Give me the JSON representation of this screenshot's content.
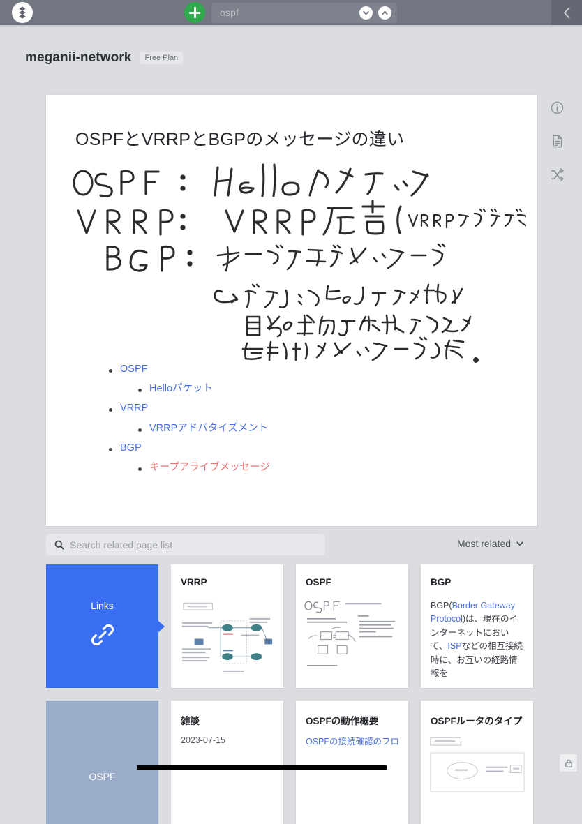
{
  "navbar": {
    "logo_name": "growi-logo",
    "create_button_label": "+",
    "search": {
      "value": "ospf",
      "placeholder": "ospf"
    },
    "search_dropdown_icon": "chevron-down-icon",
    "search_up_icon": "chevron-up-icon",
    "collapse_icon": "chevron-left-icon"
  },
  "page_header": {
    "title": "meganii-network",
    "plan_badge": "Free Plan"
  },
  "content": {
    "title": "OSPFとVRRPとBGPのメッセージの違い",
    "handwriting": {
      "lines": [
        "OSPF  :  Helloパケット",
        "VRRP  :  VRRP広告 ( VRRPアドバタイズメント )",
        "BGP   :  キープアライブメッセージ",
        "↳ ピアリング先のルータに対して",
        "自分の生存を通知するために",
        "定期的にメッセージを送る。"
      ]
    },
    "bullets": [
      {
        "label": "OSPF",
        "color": "#4a6fe0",
        "children": [
          {
            "label": "Helloパケット",
            "color": "#4a6fe0"
          }
        ]
      },
      {
        "label": "VRRP",
        "color": "#4a6fe0",
        "children": [
          {
            "label": "VRRPアドバタイズメント",
            "color": "#4a6fe0"
          }
        ]
      },
      {
        "label": "BGP",
        "color": "#4a6fe0",
        "children": [
          {
            "label": "キープアライブメッセージ",
            "color": "#ee7272"
          }
        ]
      }
    ]
  },
  "rail": {
    "items": [
      {
        "name": "info-icon",
        "label": "Page information"
      },
      {
        "name": "file-icon",
        "label": "Page attachments"
      },
      {
        "name": "shuffle-icon",
        "label": "Random page"
      }
    ]
  },
  "related": {
    "search_placeholder": "Search related page list",
    "search_icon": "search-icon",
    "sort_label": "Most related",
    "sort_icon": "chevron-down-icon"
  },
  "cards": {
    "row1": [
      {
        "type": "links",
        "title": "Links",
        "icon": "link-chain-icon"
      },
      {
        "type": "page",
        "title": "VRRP",
        "body": "",
        "preview": "diagram"
      },
      {
        "type": "page",
        "title": "OSPF",
        "body": "",
        "preview": "handwriting"
      },
      {
        "type": "page",
        "title": "BGP",
        "body_parts": [
          {
            "text": "BGP(",
            "link": false
          },
          {
            "text": "Border Gateway Protocol",
            "link": true
          },
          {
            "text": ")は、現在のインターネットにおいて、",
            "link": false
          },
          {
            "text": "ISP",
            "link": true
          },
          {
            "text": "などの相互接続時に、お互いの経路情報を",
            "link": false
          }
        ]
      }
    ],
    "row2": [
      {
        "type": "cover",
        "title": "OSPF"
      },
      {
        "type": "page",
        "title": "雑談",
        "date": "2023-07-15"
      },
      {
        "type": "page",
        "title": "OSPFの動作概要",
        "body_link": "OSPFの接続確認のフロ"
      },
      {
        "type": "page",
        "title": "OSPFルータのタイプ",
        "preview": "diagram2"
      }
    ]
  },
  "footer": {
    "lock_icon": "lock-icon"
  },
  "colors": {
    "navbar": "#717681",
    "page_bg": "#dcdde1",
    "accent_blue": "#3a6ef0",
    "link_blue": "#4a6fe0",
    "red_link": "#ee7272",
    "green": "#2fa94b",
    "cover_gray_blue": "#9bacc8"
  }
}
